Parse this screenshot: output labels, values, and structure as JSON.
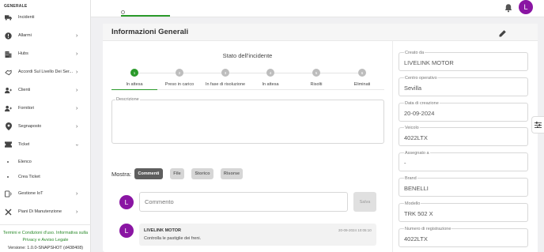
{
  "sidebar": {
    "section_title": "GENERALE",
    "items": [
      {
        "label": "Incidenti",
        "icon": "truck-icon",
        "chevron": false
      },
      {
        "label": "Allarmi",
        "icon": "alert-icon",
        "chevron": true
      },
      {
        "label": "Hubs",
        "icon": "building-icon",
        "chevron": true
      },
      {
        "label": "Accordi Sul Livello Dei Ser...",
        "icon": "handshake-icon",
        "chevron": true
      },
      {
        "label": "Clienti",
        "icon": "user-plus-icon",
        "chevron": true
      },
      {
        "label": "Fornitori",
        "icon": "user-plus-icon",
        "chevron": true
      },
      {
        "label": "Segnaposto",
        "icon": "map-pin-icon",
        "chevron": true
      },
      {
        "label": "Ticket",
        "icon": "ticket-icon",
        "chevron": "down"
      },
      {
        "label": "Gestione IoT",
        "icon": "iot-icon",
        "chevron": true
      },
      {
        "label": "Piani Di Manutenzione",
        "icon": "tools-icon",
        "chevron": true
      }
    ],
    "ticket_subitems": [
      "Elenco",
      "Crea Ticket"
    ],
    "footer_links_line1": "Termini e Condizioni d'uso. Informativa sulla",
    "footer_links_line2": "Privacy e Avviso Legale",
    "version": "Versione: 1.0.0-SNAPSHOT (d438408)"
  },
  "topbar": {
    "avatar_letter": "L"
  },
  "card": {
    "title": "Informazioni Generali",
    "state_title": "Stato dell'incidente",
    "steps": [
      {
        "number": "1",
        "label": "In attesa",
        "active": true
      },
      {
        "number": "2",
        "label": "Preso in carico",
        "active": false
      },
      {
        "number": "3",
        "label": "In fase di risoluzione",
        "active": false
      },
      {
        "number": "4",
        "label": "In attesa",
        "active": false
      },
      {
        "number": "5",
        "label": "Risolti",
        "active": false
      },
      {
        "number": "6",
        "label": "Eliminati",
        "active": false
      }
    ],
    "description_label": "Descrizione",
    "description_value": "",
    "mostra_label": "Mostra:",
    "filters": [
      {
        "label": "Commenti",
        "active": true
      },
      {
        "label": "File",
        "active": false
      },
      {
        "label": "Storico",
        "active": false
      },
      {
        "label": "Risorse",
        "active": false
      }
    ],
    "comment_placeholder": "Commento",
    "save_label": "Salva",
    "avatar_letter": "L",
    "comments": [
      {
        "author": "LIVELINK MOTOR",
        "date": "20-09-2024 10:05:10",
        "text": "Controlla le pastiglie dei freni.",
        "avatar_letter": "L"
      }
    ]
  },
  "details": [
    {
      "label": "Creato da",
      "value": "LIVELINK MOTOR"
    },
    {
      "label": "Centro operativo",
      "value": "Sevilla"
    },
    {
      "label": "Data di creazione",
      "value": "20-09-2024"
    },
    {
      "label": "Veicolo",
      "value": "4022LTX"
    },
    {
      "label": "Assegnato a",
      "value": "-"
    },
    {
      "label": "Brand",
      "value": "BENELLI"
    },
    {
      "label": "Modello",
      "value": "TRK 502 X"
    },
    {
      "label": "Numero di registrazione",
      "value": "4022LTX"
    }
  ],
  "colors": {
    "accent_green": "#2a9a2a",
    "avatar_purple": "#8a15a3"
  }
}
